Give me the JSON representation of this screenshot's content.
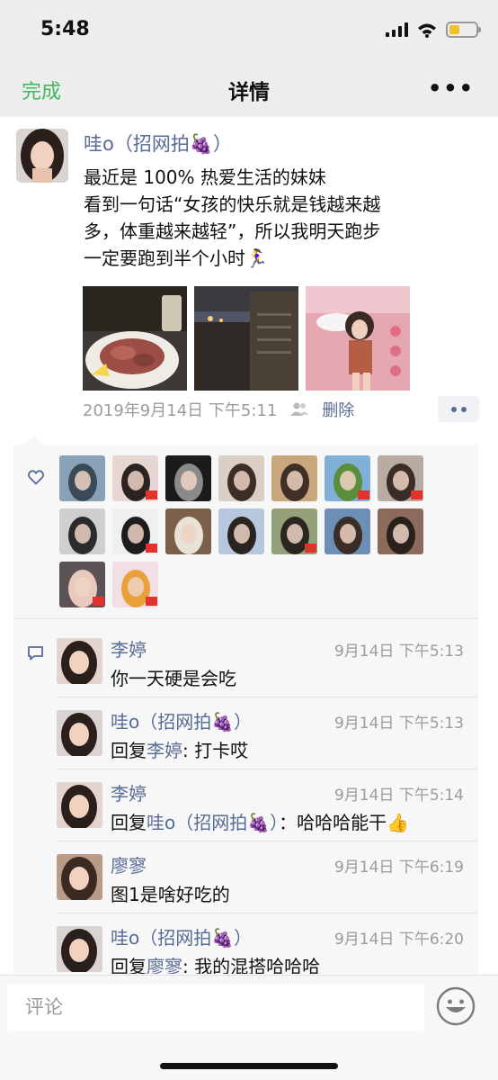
{
  "status_bar": {
    "time": "5:48"
  },
  "nav": {
    "done_label": "完成",
    "title": "详情",
    "more_label": "•••"
  },
  "post": {
    "author": "哇o（招网拍🍇）",
    "text": "最近是 100% 热爱生活的妹妹\n看到一句话“女孩的快乐就是钱越来越\n多，体重越来越轻”，所以我明天跑步\n一定要跑到半个小时🏃‍♀️",
    "date": "2019年9月14日 下午5:11",
    "delete_label": "删除",
    "photos": [
      "food-photo",
      "dusk-drink-photo",
      "pink-wall-photo"
    ]
  },
  "likes": {
    "count": 16
  },
  "comments": [
    {
      "author": "李婷",
      "time": "9月14日 下午5:13",
      "reply_prefix": "",
      "reply_to": "",
      "text": "你一天硬是会吃"
    },
    {
      "author": "哇o（招网拍🍇）",
      "time": "9月14日 下午5:13",
      "reply_prefix": "回复",
      "reply_to": "李婷",
      "text": ": 打卡哎"
    },
    {
      "author": "李婷",
      "time": "9月14日 下午5:14",
      "reply_prefix": "回复",
      "reply_to": "哇o（招网拍🍇）",
      "text": "：哈哈哈能干👍"
    },
    {
      "author": "廖寥",
      "time": "9月14日 下午6:19",
      "reply_prefix": "",
      "reply_to": "",
      "text": "图1是啥好吃的"
    },
    {
      "author": "哇o（招网拍🍇）",
      "time": "9月14日 下午6:20",
      "reply_prefix": "回复",
      "reply_to": "廖寥",
      "text": ": 我的混搭哈哈哈"
    }
  ],
  "input": {
    "placeholder": "评论"
  },
  "colors": {
    "accent_green": "#3fb860",
    "link_blue": "#576b95",
    "meta_gray": "#9b9b9b"
  },
  "icons": [
    "signal-icon",
    "wifi-icon",
    "battery-icon",
    "friends-icon",
    "heart-icon",
    "comment-icon",
    "emoji-icon"
  ]
}
